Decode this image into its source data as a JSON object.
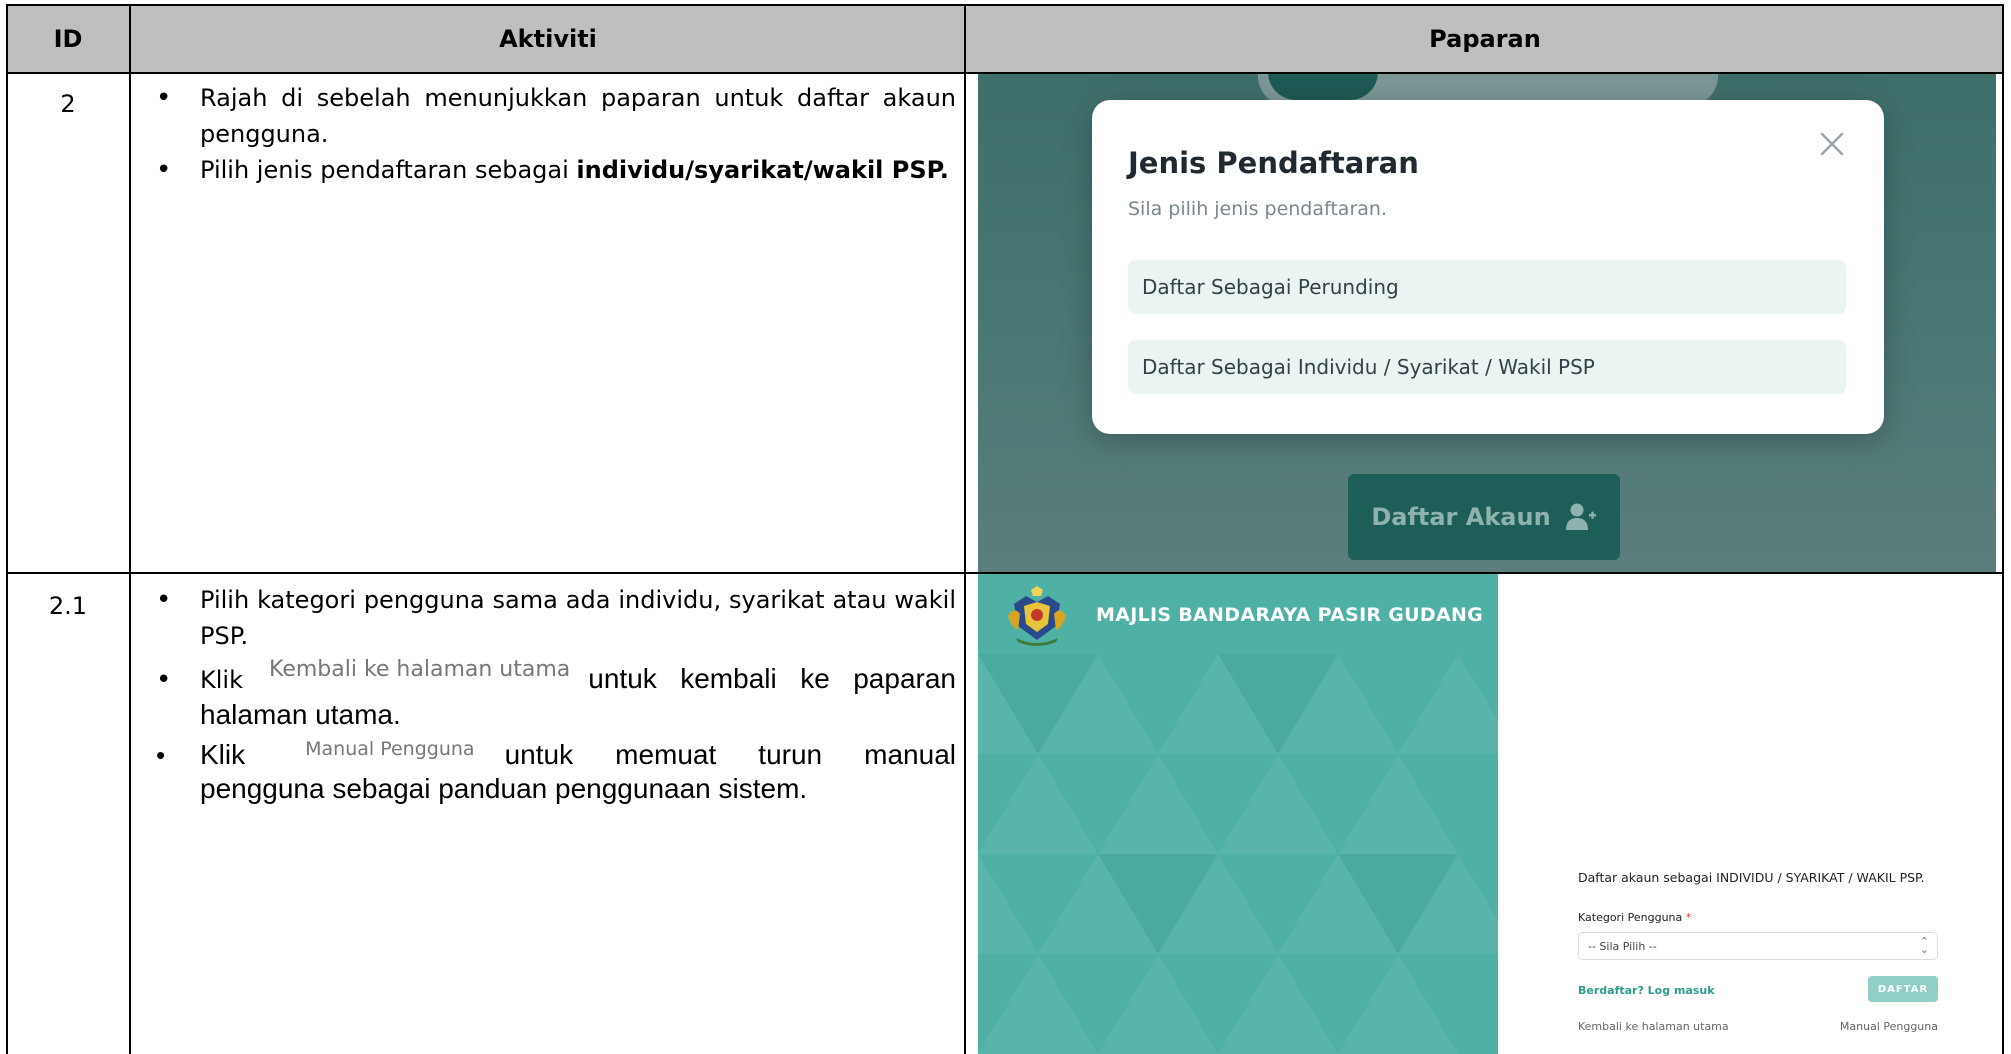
{
  "table": {
    "headers": {
      "id": "ID",
      "activity": "Aktiviti",
      "display": "Paparan"
    }
  },
  "rows": [
    {
      "id": "2",
      "bullets": [
        {
          "text": "Rajah di sebelah menunjukkan paparan untuk daftar akaun pengguna."
        },
        {
          "prefix": "Pilih jenis pendaftaran sebagai ",
          "bold": "individu/syarikat/wakil PSP."
        }
      ]
    },
    {
      "id": "2.1",
      "bullets": [
        {
          "text": "Pilih kategori pengguna sama ada individu, syarikat atau wakil PSP."
        },
        {
          "prefix": "Klik",
          "inline": "Kembali ke halaman utama",
          "suffix": "untuk kembali ke paparan halaman utama."
        },
        {
          "prefix": "Klik",
          "inline": "Manual Pengguna",
          "suffix": "untuk memuat turun manual pengguna sebagai panduan penggunaan sistem."
        }
      ]
    }
  ],
  "screenshot1": {
    "modal_title": "Jenis Pendaftaran",
    "modal_subtitle": "Sila pilih jenis pendaftaran.",
    "option_1": "Daftar Sebagai Perunding",
    "option_2": "Daftar Sebagai Individu / Syarikat / Wakil PSP",
    "register_button": "Daftar Akaun",
    "icons": {
      "close": "close-icon",
      "register": "user-plus-icon"
    },
    "colors": {
      "backdrop": "#4a7874",
      "button": "#1d5e58",
      "option_bg": "#eaf5f2"
    }
  },
  "screenshot2": {
    "brand": "MAJLIS BANDARAYA PASIR GUDANG",
    "form_title": "Daftar akaun sebagai INDIVIDU / SYARIKAT / WAKIL PSP.",
    "category_label": "Kategori Pengguna",
    "required_mark": "*",
    "select_value": "-- Sila Pilih --",
    "login_link": "Berdaftar? Log masuk",
    "submit_button": "DAFTAR",
    "back_link": "Kembali ke halaman utama",
    "manual_link": "Manual Pengguna",
    "colors": {
      "panel": "#4fb1a6",
      "submit": "#8fcfc6",
      "link": "#2f9c8c"
    }
  }
}
